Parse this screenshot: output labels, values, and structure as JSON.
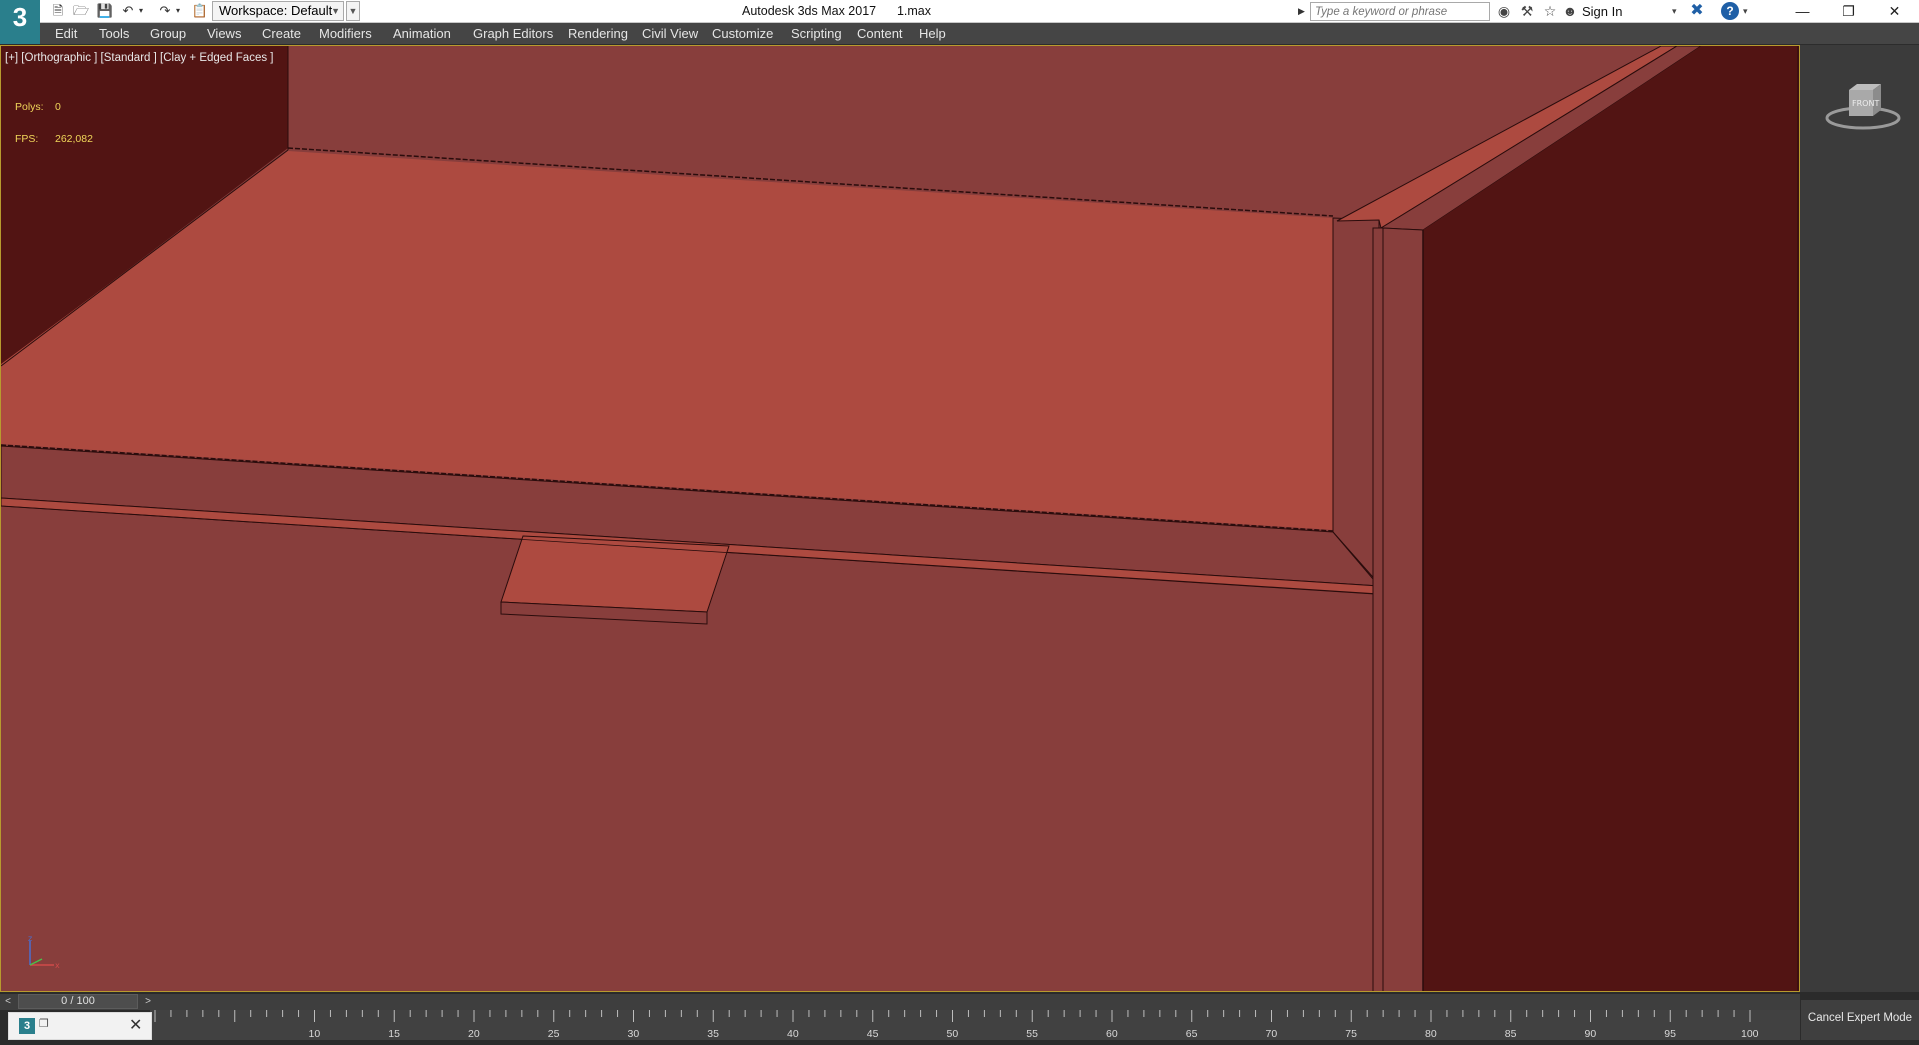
{
  "app": {
    "logo_text": "3",
    "title": "Autodesk 3ds Max 2017      1.max",
    "workspace_label": "Workspace: Default"
  },
  "search": {
    "placeholder": "Type a keyword or phrase"
  },
  "account": {
    "sign_in_label": "Sign In"
  },
  "menu": {
    "items": [
      "Edit",
      "Tools",
      "Group",
      "Views",
      "Create",
      "Modifiers",
      "Animation",
      "Graph Editors",
      "Rendering",
      "Civil View",
      "Customize",
      "Scripting",
      "Content",
      "Help"
    ]
  },
  "viewport": {
    "label": "[+] [Orthographic ] [Standard ] [Clay + Edged Faces ]",
    "polys_label": "Polys:",
    "polys_value": "0",
    "fps_label": "FPS:",
    "fps_value": "262,082",
    "background_color": "#883e3c",
    "top_surface_color": "#ad4a40",
    "dark_wall_color": "#521413"
  },
  "viewcube": {
    "label": "FRONT"
  },
  "timeline": {
    "frame_label": "0 / 100",
    "ticks": [
      "10",
      "15",
      "20",
      "25",
      "30",
      "35",
      "40",
      "45",
      "50",
      "55",
      "60",
      "65",
      "70",
      "75",
      "80",
      "85",
      "90",
      "95",
      "100"
    ]
  },
  "status": {
    "cancel_expert_mode": "Cancel Expert Mode"
  },
  "icons": {
    "logo": "3ds-max-logo",
    "new": "new-file-icon",
    "open": "open-file-icon",
    "save": "save-icon",
    "undo": "undo-icon",
    "redo": "redo-icon",
    "project": "project-folder-icon",
    "binoculars": "binoculars-icon",
    "tools": "tools-icon",
    "star": "favorites-star-icon",
    "user": "user-icon",
    "exchange": "autodesk-exchange-icon",
    "help": "help-icon",
    "minimize": "minimize-icon",
    "restore": "restore-icon",
    "close": "close-icon"
  }
}
